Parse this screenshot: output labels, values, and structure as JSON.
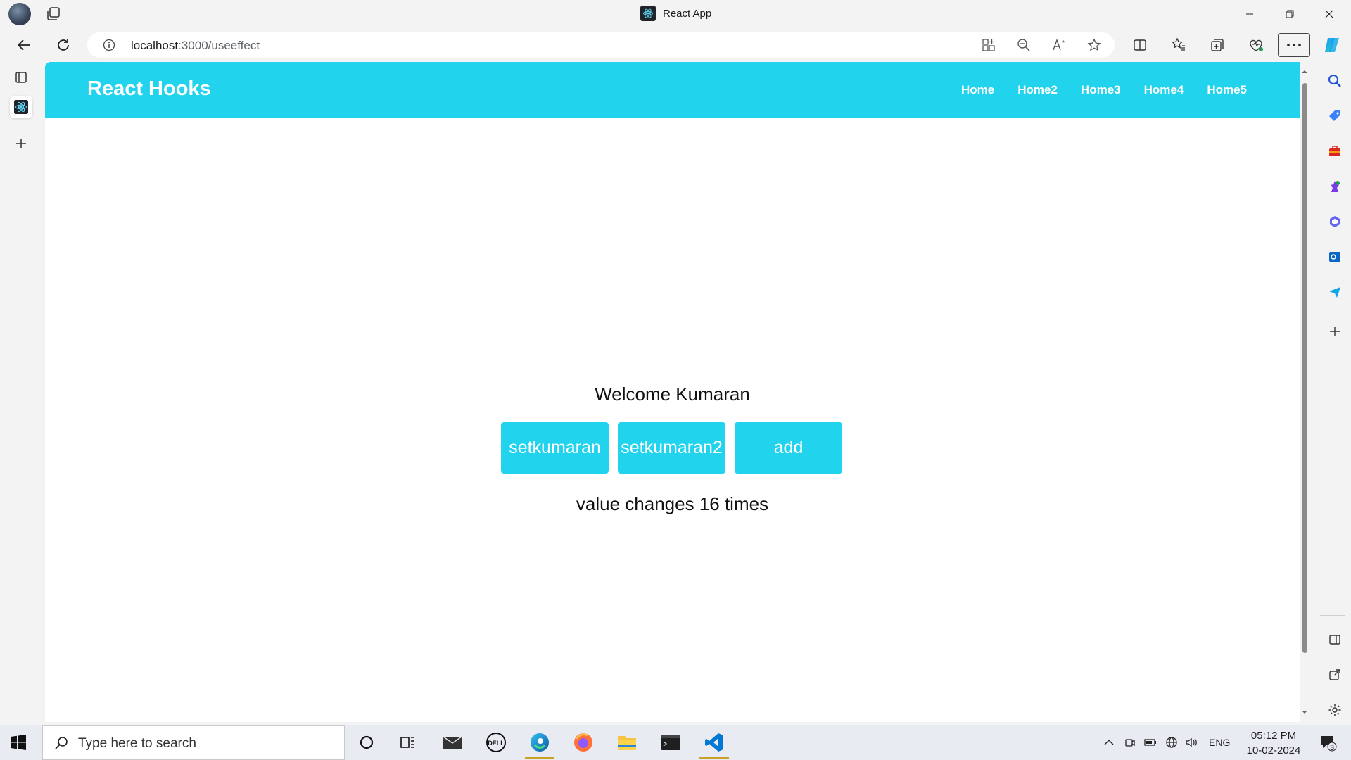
{
  "browser": {
    "window_title": "React App",
    "url_host": "localhost",
    "url_path": ":3000/useeffect"
  },
  "page": {
    "brand": "React Hooks",
    "nav": [
      "Home",
      "Home2",
      "Home3",
      "Home4",
      "Home5"
    ],
    "welcome": "Welcome Kumaran",
    "buttons": [
      "setkumaran",
      "setkumaran2",
      "add"
    ],
    "changes": "value changes 16 times"
  },
  "colors": {
    "accent": "#22d3ee"
  },
  "taskbar": {
    "search_placeholder": "Type here to search",
    "lang": "ENG",
    "time": "05:12 PM",
    "date": "10-02-2024",
    "notification_count": "3"
  }
}
